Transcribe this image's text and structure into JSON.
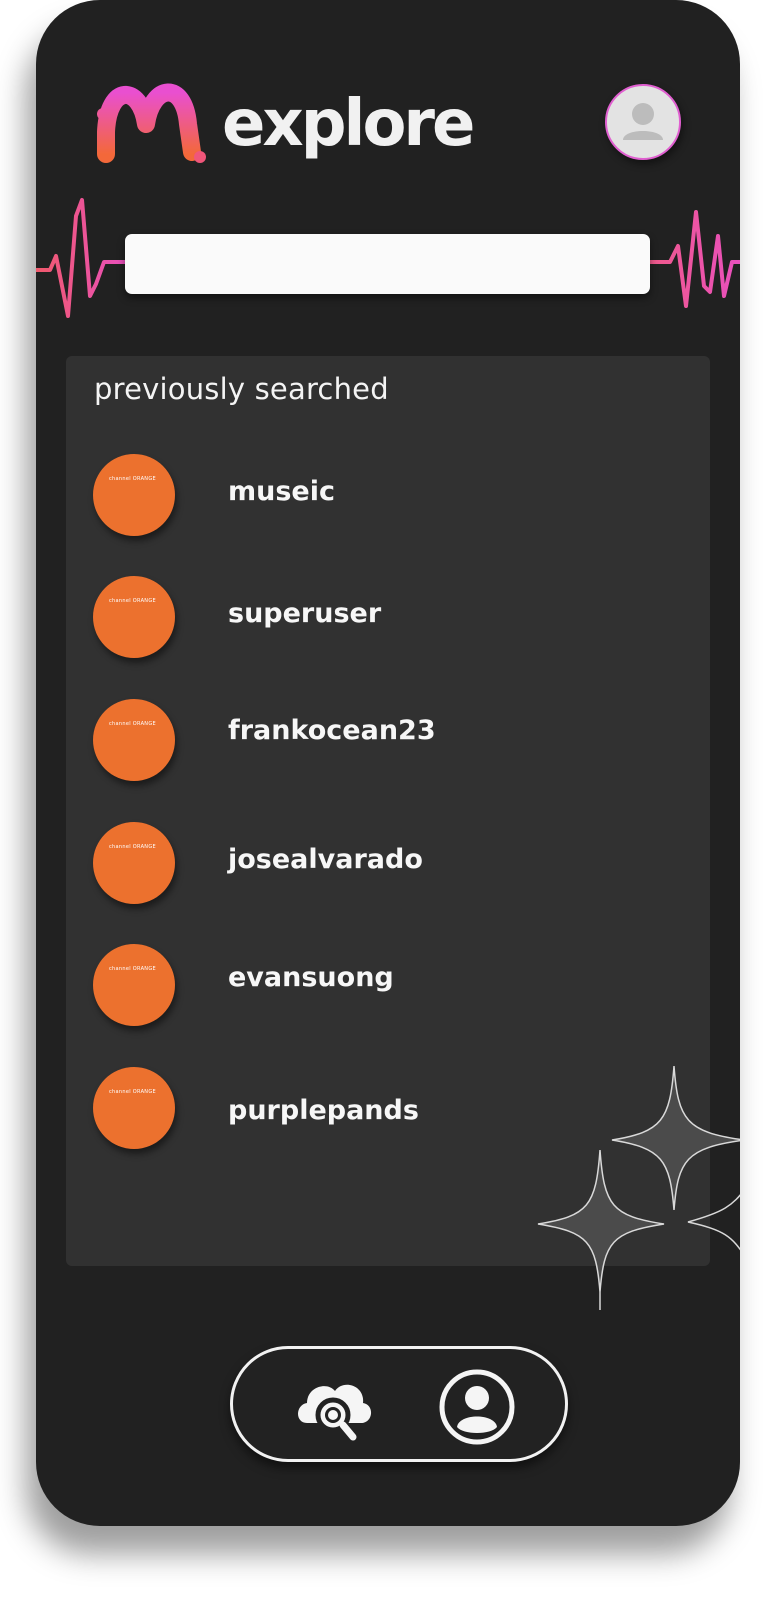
{
  "header": {
    "title": "explore",
    "logo_icon": "wave-m-logo-icon",
    "avatar_icon": "user-avatar-icon"
  },
  "search": {
    "value": "",
    "placeholder": ""
  },
  "previously_searched": {
    "title": "previously searched",
    "album_art_text": "channel ORANGE",
    "items": [
      {
        "name": "museic"
      },
      {
        "name": "superuser"
      },
      {
        "name": "frankocean23"
      },
      {
        "name": "josealvarado"
      },
      {
        "name": "evansuong"
      },
      {
        "name": "purplepands"
      }
    ]
  },
  "nav": {
    "search_icon": "cloud-search-icon",
    "profile_icon": "profile-circle-icon"
  },
  "colors": {
    "background": "#212121",
    "panel": "#313131",
    "accent_orange": "#ec712e",
    "gradient_pink": "#e94fd0",
    "gradient_orange": "#f0663a",
    "text": "#f4f4f4"
  }
}
